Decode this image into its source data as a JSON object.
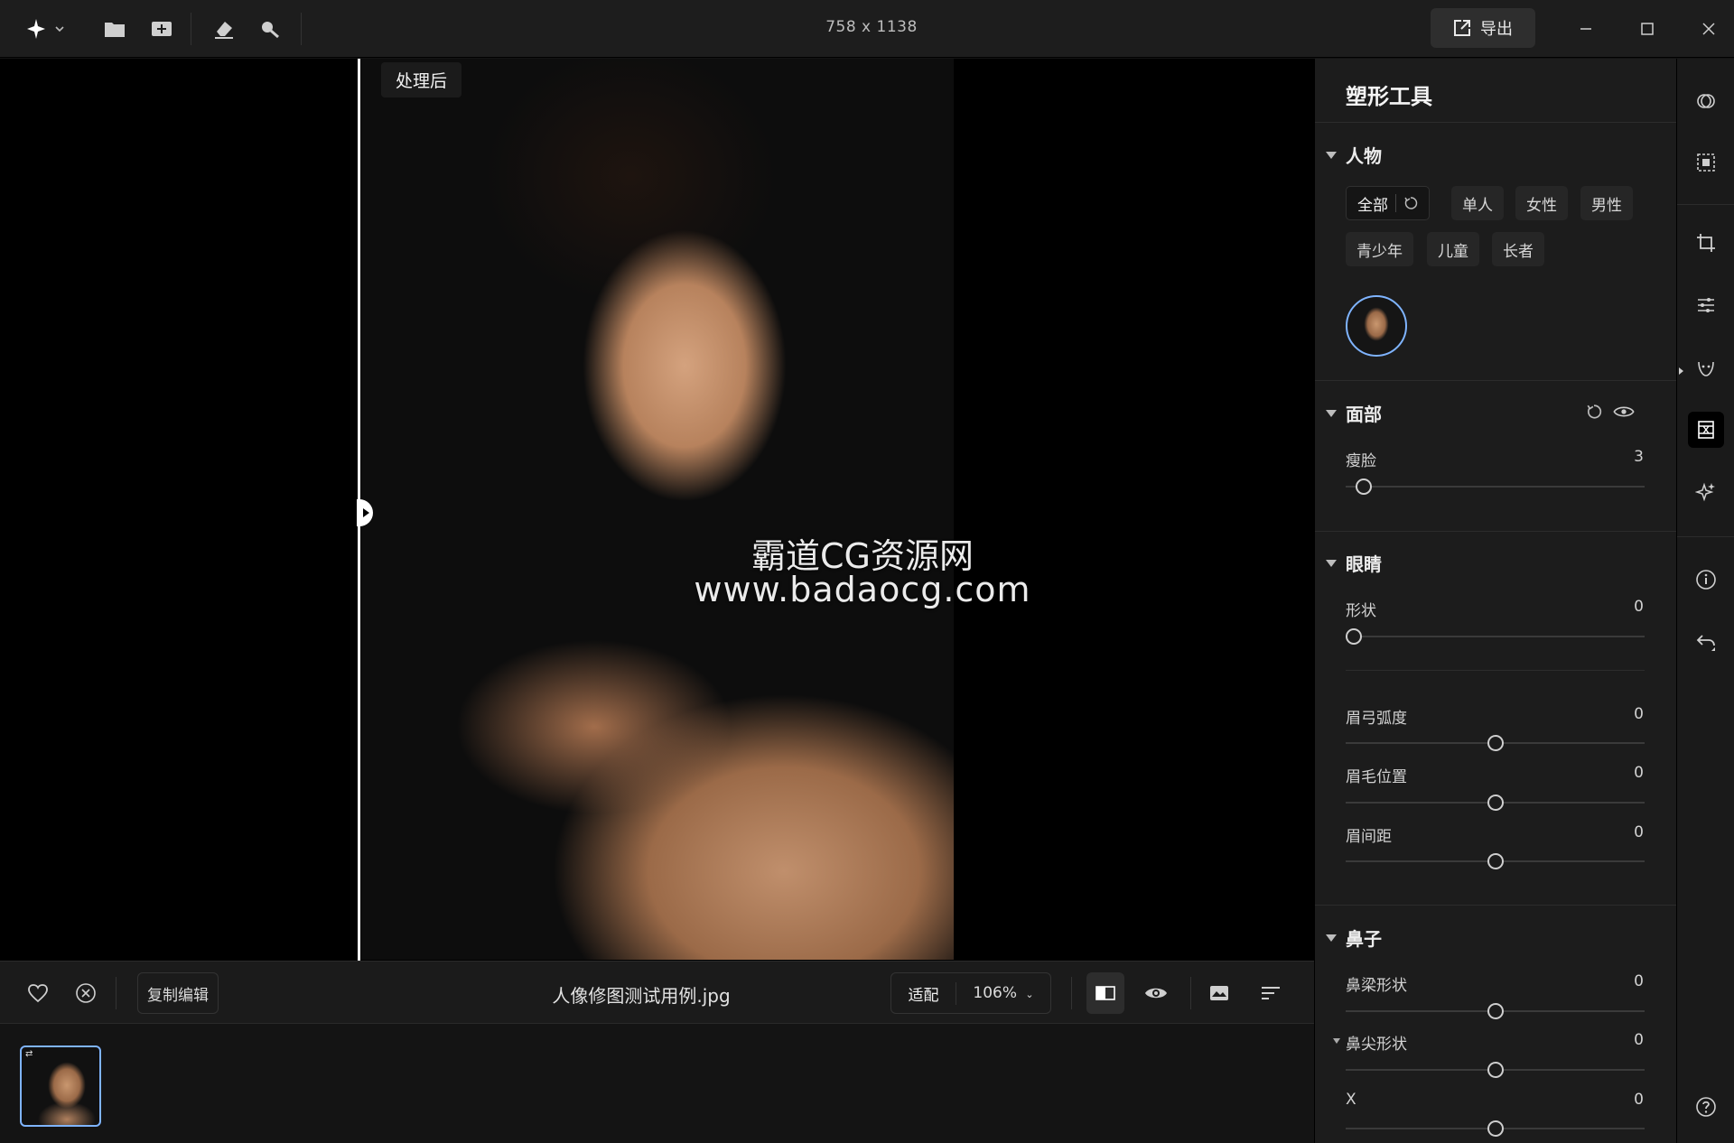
{
  "topbar": {
    "dimensions": "758 x 1138",
    "export_label": "导出"
  },
  "canvas": {
    "after_label": "处理后",
    "watermark_line1": "霸道CG资源网",
    "watermark_line2": "www.badaocg.com"
  },
  "bottombar": {
    "copy_edit_label": "复制编辑",
    "file_name": "人像修图测试用例.jpg",
    "fit_label": "适配",
    "zoom_label": "106%"
  },
  "panel": {
    "title": "塑形工具",
    "people": {
      "title": "人物",
      "chips": [
        "全部",
        "单人",
        "女性",
        "男性",
        "青少年",
        "儿童",
        "长者"
      ]
    },
    "face": {
      "title": "面部",
      "sliders": [
        {
          "label": "瘦脸",
          "value": "3",
          "position": 0.06
        }
      ]
    },
    "eyes": {
      "title": "眼睛",
      "sliders": [
        {
          "label": "形状",
          "value": "0",
          "position": 0.0
        },
        {
          "label": "眉弓弧度",
          "value": "0",
          "position": 0.5
        },
        {
          "label": "眉毛位置",
          "value": "0",
          "position": 0.5
        },
        {
          "label": "眉间距",
          "value": "0",
          "position": 0.5
        }
      ]
    },
    "nose": {
      "title": "鼻子",
      "sliders": [
        {
          "label": "鼻梁形状",
          "value": "0",
          "position": 0.5
        },
        {
          "label": "鼻尖形状",
          "value": "0",
          "position": 0.5
        },
        {
          "label": "X",
          "value": "0",
          "position": 0.5
        }
      ]
    }
  },
  "colors": {
    "accent": "#7fb4ff",
    "panel_bg": "#1c1c1c",
    "canvas_bg": "#000000"
  }
}
